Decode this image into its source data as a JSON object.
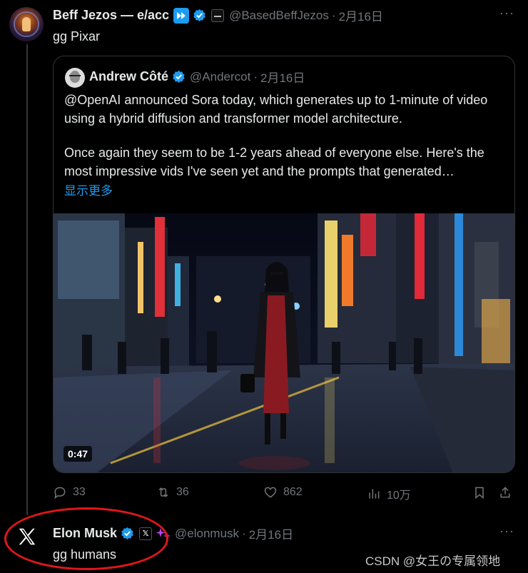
{
  "tweet1": {
    "name": "Beff Jezos — e/acc",
    "handle": "@BasedBeffJezos",
    "date": "2月16日",
    "text": "gg Pixar",
    "more": "···"
  },
  "quote": {
    "name": "Andrew Côté",
    "handle": "@Andercot",
    "date": "2月16日",
    "paragraph1": "@OpenAI announced Sora today, which generates up to 1-minute of video using a hybrid diffusion and transformer model architecture.",
    "paragraph2": "Once again they seem to be 1-2 years ahead of everyone else. Here's the most impressive vids I've seen yet and the prompts that generated…",
    "show_more": "显示更多",
    "video_duration": "0:47"
  },
  "actions": {
    "replies": "33",
    "retweets": "36",
    "likes": "862",
    "views": "10万"
  },
  "tweet2": {
    "name": "Elon Musk",
    "handle": "@elonmusk",
    "date": "2月16日",
    "text": "gg humans",
    "badge": "𝕏",
    "more": "···"
  },
  "watermark": "CSDN @女王の专属领地",
  "colors": {
    "accent": "#1d9bf0",
    "muted": "#71767b",
    "highlight_circle": "#e1161b"
  }
}
